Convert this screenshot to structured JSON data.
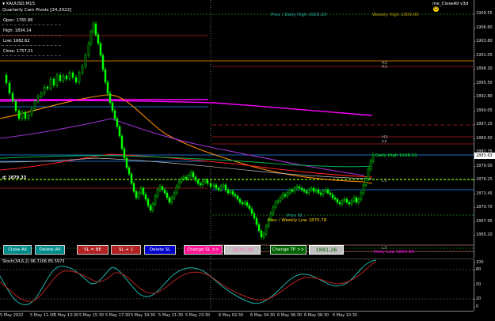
{
  "header": {
    "symbol_title": "XAUUSD,M15",
    "pivot_title": "Quarterly Cam Pivots [24,2022]",
    "ea_name": "me_CloseAll v3d"
  },
  "ohlc": [
    {
      "label": "Open: 1765.88"
    },
    {
      "label": "High: 1834.14"
    },
    {
      "label": "Low: 1682.62"
    },
    {
      "label": "Close: 1757.21"
    }
  ],
  "price_scale": {
    "ticks": [
      "1909.55",
      "1906.60",
      "1903.80",
      "1901.05",
      "1898.30",
      "1895.50",
      "1892.80",
      "1890.05",
      "1887.25",
      "1884.50",
      "1881.75",
      "1879.00",
      "1876.25",
      "1873.45",
      "1870.70",
      "1867.95",
      "1865.20"
    ],
    "current_price": "1883.63",
    "current_price_value": 1883.63
  },
  "stoch_scale": {
    "ticks": [
      "100",
      "80",
      "50",
      "20",
      "0"
    ]
  },
  "time_axis": {
    "labels": [
      "5 May 2022",
      "5 May 11:30",
      "5 May 13:30",
      "5 May 15:30",
      "5 May 17:30",
      "5 May 19:30",
      "5 May 21:30",
      "5 May 23:30",
      "6 May 02:30",
      "6 May 04:30",
      "6 May 06:30",
      "6 May 08:30",
      "6 May 10:30"
    ]
  },
  "chart_labels": {
    "prev_daily_high": "Prev / Daily High 1929.33",
    "weekly_high": "Weekly High 1909.05",
    "r0": "R0",
    "r1": "R1",
    "h3": "H3",
    "pp": "PP",
    "daily_high": "Daily High 1938.51",
    "left_small": "d: 1879.33",
    "right_small": "L3",
    "prev_weekly_low": "Prev / Weekly Low 1870.78",
    "prev_weekly_low_short": "Prev W...",
    "daily_low": "Daily Low 1865.86",
    "l3": "L3"
  },
  "toolbar": {
    "close_all": "Close All",
    "delete_all": "Delete All",
    "sl_be": "SL = BE",
    "sl_plus1": "SL + 1",
    "delete_sl": "Delete SL",
    "change_sl": "Change SL >>",
    "sl_value": "1879.38",
    "change_tp": "Change TP >>",
    "tp_value": "1881.26"
  },
  "stoch": {
    "title": "Stoch(34,6,2) 96.7206 85.5973"
  },
  "colors": {
    "candle": "#00ff00",
    "ma_orange": "#ff8c00",
    "ma_magenta": "#ff00ff",
    "ma_purple": "#9932cc",
    "ma_red": "#ff0000",
    "ma_green": "#00b050",
    "level_blue": "#1e90ff",
    "level_red": "#b22222",
    "level_green": "#00ff00",
    "pivot_peach": "#ffb27f",
    "close_btn": "#008b8b",
    "sl_btn": "#b22222",
    "delete_sl_btn": "#0000cd",
    "change_sl_btn": "#ff1493",
    "change_tp_btn": "#006400",
    "stoch_main": "#20b2aa",
    "stoch_signal": "#b22222"
  }
}
